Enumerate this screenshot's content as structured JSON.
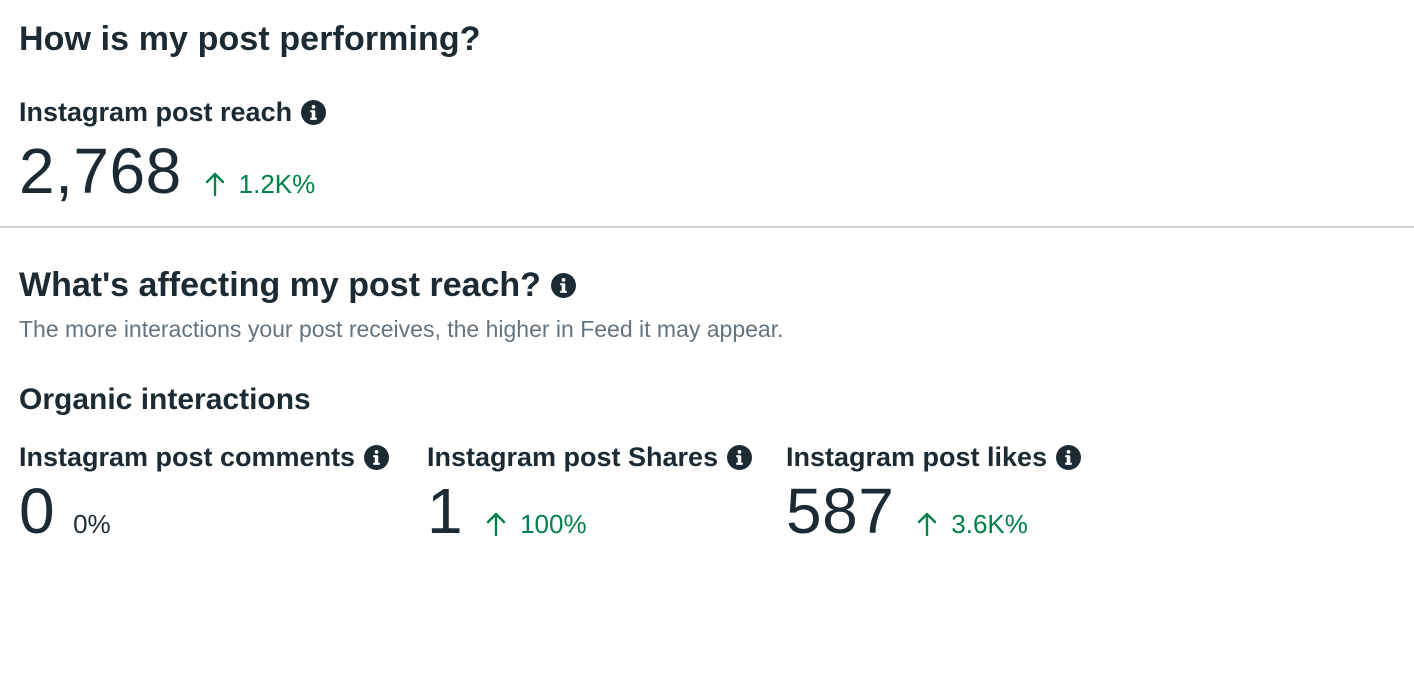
{
  "performance": {
    "title": "How is my post performing?",
    "reach": {
      "label": "Instagram post reach",
      "value": "2,768",
      "change": "1.2K%",
      "trend": "up"
    }
  },
  "affecting": {
    "title": "What's affecting my post reach?",
    "description": "The more interactions your post receives, the higher in Feed it may appear.",
    "organic": {
      "title": "Organic interactions",
      "metrics": [
        {
          "label": "Instagram post comments",
          "value": "0",
          "change": "0%",
          "trend": "neutral"
        },
        {
          "label": "Instagram post Shares",
          "value": "1",
          "change": "100%",
          "trend": "up"
        },
        {
          "label": "Instagram post likes",
          "value": "587",
          "change": "3.6K%",
          "trend": "up"
        }
      ]
    }
  },
  "icons": {
    "info": "info-icon",
    "trend_up": "arrow-up-icon"
  },
  "colors": {
    "text": "#1c2b33",
    "positive": "#00804a",
    "muted": "#65737e",
    "divider": "#cfd3d6"
  }
}
